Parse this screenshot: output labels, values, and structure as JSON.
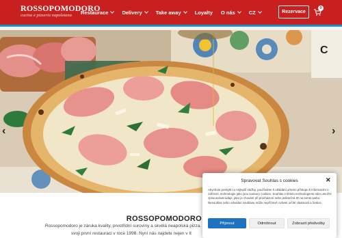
{
  "header": {
    "logo_main": "ROSSOPOMODORO",
    "logo_sub": "cucina e pizzeria napoletana",
    "nav": [
      {
        "label": "Restaurace",
        "has_dropdown": true
      },
      {
        "label": "Delivery",
        "has_dropdown": true
      },
      {
        "label": "Take away",
        "has_dropdown": true
      },
      {
        "label": "Loyalty",
        "has_dropdown": false
      },
      {
        "label": "O nás",
        "has_dropdown": true
      },
      {
        "label": "CZ",
        "has_dropdown": true
      }
    ],
    "reserve_label": "Rezervace",
    "cart_count": "0",
    "colors": {
      "header_bg": "#c8201e",
      "accent_line": "#1b8fd6"
    }
  },
  "hero": {
    "prev_arrow": "‹",
    "next_arrow": "›",
    "image_icon": "pizza-photo"
  },
  "intro": {
    "title": "ROSSOPOMODORO",
    "line1": "Rossopomodoro je záruka kvality, prvotřídní suroviny a skvělá neapolská pizza. Jsme n",
    "line2": "svoji první restauraci v roce 1998. Nyní nás najdete nejen v It"
  },
  "cookie": {
    "title": "Spravovat Souhlas s cookies",
    "close": "✕",
    "text": "Abychom poskytli co nejlepší služby, používáme k ukládání a/nebo přístupu k informacím o zařízení, technologie jako jsou soubory cookies. Souhlas s těmito technologiemi nám umožní zpracovávat údaje, jako je chování při procházení nebo jedinečná ID na tomto webu. Nesouhlas nebo odvolání souhlasu může nepříznivě ovlivnit určité vlastnosti a funkce.",
    "accept": "Přijmout",
    "deny": "Odmítnout",
    "prefs": "Zobrazit předvolby",
    "colors": {
      "accept_bg": "#1e73be"
    }
  }
}
